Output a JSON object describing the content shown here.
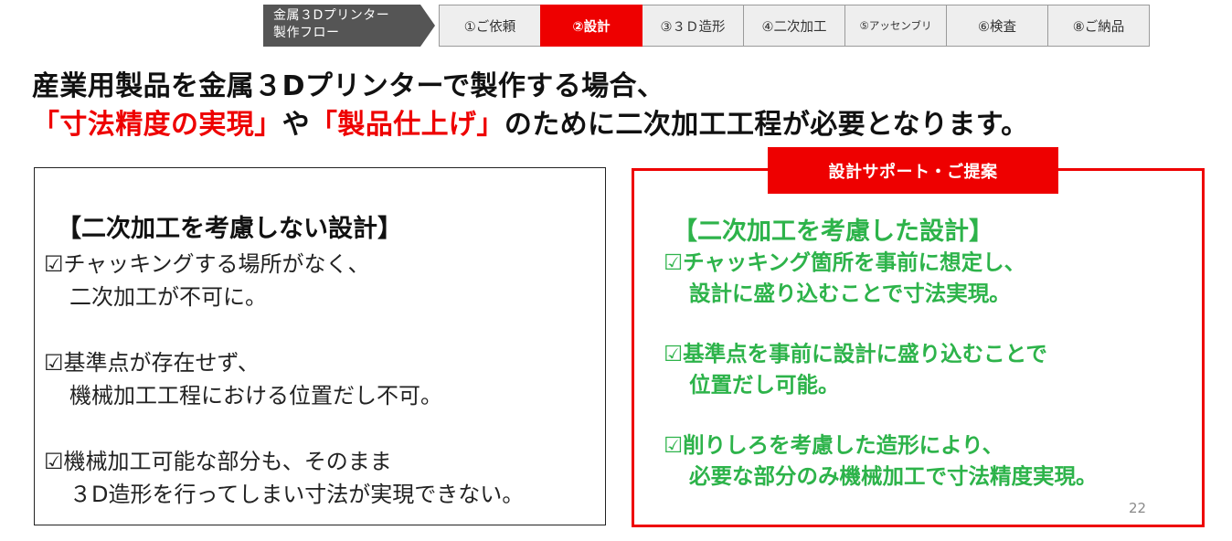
{
  "flow": {
    "label_line1": "金属３Dプリンター",
    "label_line2": "製作フロー",
    "steps": [
      {
        "label": "①ご依頼",
        "active": false
      },
      {
        "label": "②設計",
        "active": true
      },
      {
        "label": "③３Ｄ造形",
        "active": false
      },
      {
        "label": "④二次加工",
        "active": false
      },
      {
        "label": "⑤アッセンブリ",
        "active": false
      },
      {
        "label": "⑥検査",
        "active": false
      },
      {
        "label": "⑧ご納品",
        "active": false
      }
    ]
  },
  "headline": {
    "line1": "産業用製品を金属３Dプリンターで製作する場合、",
    "line2_accent1": "「寸法精度の実現」",
    "line2_mid": "や",
    "line2_accent2": "「製品仕上げ」",
    "line2_end": "のために二次加工工程が必要となります。"
  },
  "left_panel": {
    "title": "【二次加工を考慮しない設計】",
    "points": [
      {
        "line1": "☑チャッキングする場所がなく、",
        "line2": "二次加工が不可に。"
      },
      {
        "line1": "☑基準点が存在せず、",
        "line2": "機械加工工程における位置だし不可。"
      },
      {
        "line1": "☑機械加工可能な部分も、そのまま",
        "line2": "３D造形を行ってしまい寸法が実現できない。"
      }
    ]
  },
  "right_panel": {
    "tab": "設計サポート・ご提案",
    "title": "【二次加工を考慮した設計】",
    "points": [
      {
        "line1": "☑チャッキング箇所を事前に想定し、",
        "line2": "設計に盛り込むことで寸法実現。"
      },
      {
        "line1": "☑基準点を事前に設計に盛り込むことで",
        "line2": "位置だし可能。"
      },
      {
        "line1": "☑削りしろを考慮した造形により、",
        "line2": "必要な部分のみ機械加工で寸法精度実現。"
      }
    ]
  },
  "page_number": "22",
  "colors": {
    "accent_red": "#ee0000",
    "green": "#2db34a",
    "nav_gray": "#555555",
    "step_bg": "#eeeeee"
  }
}
